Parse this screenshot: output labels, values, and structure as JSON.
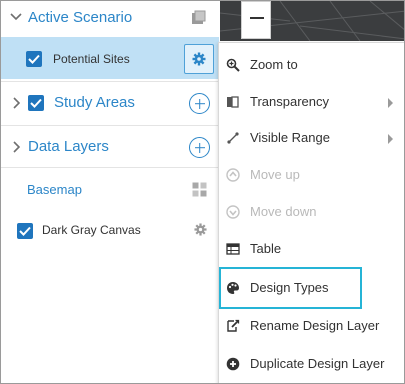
{
  "panel": {
    "scenario_label": "Active Scenario",
    "potential_sites_label": "Potential Sites",
    "study_areas_label": "Study Areas",
    "data_layers_label": "Data Layers",
    "basemap_label": "Basemap",
    "dark_gray_label": "Dark Gray Canvas"
  },
  "menu": {
    "items": [
      {
        "label": "Zoom to",
        "icon": "zoom-to-icon",
        "enabled": true
      },
      {
        "label": "Transparency",
        "icon": "transparency-icon",
        "enabled": true,
        "submenu": true
      },
      {
        "label": "Visible Range",
        "icon": "visible-range-icon",
        "enabled": true,
        "submenu": true
      },
      {
        "label": "Move up",
        "icon": "move-up-icon",
        "enabled": false
      },
      {
        "label": "Move down",
        "icon": "move-down-icon",
        "enabled": false
      },
      {
        "label": "Table",
        "icon": "table-icon",
        "enabled": true
      },
      {
        "label": "Design Types",
        "icon": "palette-icon",
        "enabled": true,
        "highlighted": true
      },
      {
        "label": "Rename Design Layer",
        "icon": "rename-icon",
        "enabled": true
      },
      {
        "label": "Duplicate Design Layer",
        "icon": "duplicate-icon",
        "enabled": true
      }
    ]
  },
  "colors": {
    "accent": "#2c86c8",
    "selected_row": "#bfe0f5",
    "checkbox": "#1f75bd",
    "highlight_box": "#25b4d6",
    "map_background": "#3b3d3f"
  }
}
